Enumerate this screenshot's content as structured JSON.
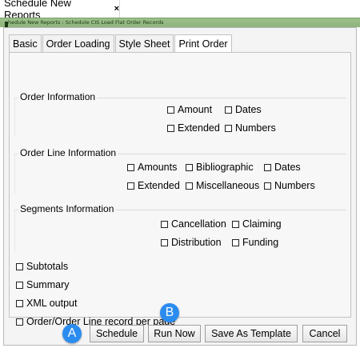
{
  "window_tab": {
    "title": "Schedule New Reports",
    "close_symbol": "×"
  },
  "breadcrumb": "hedule New Reports : Schedule CIS Load Flat Order Records",
  "tabs": [
    "Basic",
    "Order Loading",
    "Style Sheet",
    "Print Order"
  ],
  "active_tab": "Print Order",
  "order_info": {
    "title": "Order Information",
    "options": [
      "Amount",
      "Dates",
      "Extended",
      "Numbers"
    ]
  },
  "order_line_info": {
    "title": "Order Line Information",
    "options": [
      "Amounts",
      "Bibliographic",
      "Dates",
      "Extended",
      "Miscellaneous",
      "Numbers"
    ]
  },
  "segments_info": {
    "title": "Segments Information",
    "options": [
      "Cancellation",
      "Claiming",
      "Distribution",
      "Funding"
    ]
  },
  "standalone_options": [
    "Subtotals",
    "Summary",
    "XML output",
    "Order/Order Line record per page"
  ],
  "buttons": {
    "schedule": "Schedule",
    "run_now": "Run Now",
    "save_template": "Save As Template",
    "cancel": "Cancel"
  },
  "markers": {
    "a": "A",
    "b": "B"
  },
  "colors": {
    "accent_marker": "#2b8cf0",
    "title_strip": "#8fb37d"
  }
}
